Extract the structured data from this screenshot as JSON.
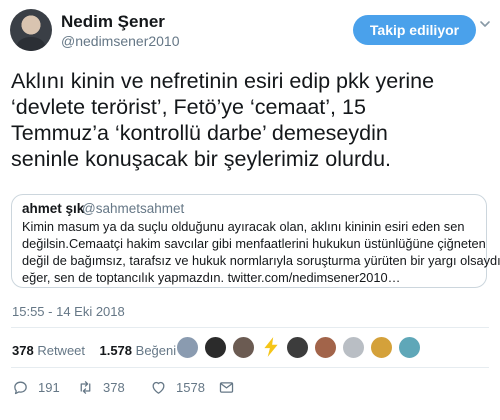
{
  "author": {
    "name": "Nedim Şener",
    "handle": "@nedimsener2010"
  },
  "follow_button": {
    "label": "Takip ediliyor"
  },
  "tweet": {
    "lines": [
      "Aklını kinin ve nefretinin esiri edip pkk yerine",
      "‘devlete terörist’, Fetö’ye ‘cemaat’, 15",
      "Temmuz’a ‘kontrollü darbe’ demeseydin",
      "seninle konuşacak bir şeylerimiz olurdu."
    ]
  },
  "quoted": {
    "name": "ahmet şık",
    "handle": "@sahmetsahmet",
    "lines": [
      "Kimin masum ya da suçlu olduğunu ayıracak olan, aklını kininin esiri eden sen",
      "değilsin.Cemaatçi hakim savcılar gibi menfaatlerini hukukun üstünlüğüne çiğneten",
      "değil de bağımsız, tarafsız ve hukuk normlarıyla soruşturma yürüten bir yargı olsaydı",
      "eğer, sen de toptancılık yapmazdın. twitter.com/nedimsener2010…"
    ]
  },
  "timestamp": "15:55 - 14 Eki 2018",
  "stats": {
    "retweet_count": "378",
    "retweet_label": "Retweet",
    "like_count": "1.578",
    "like_label": "Beğeni"
  },
  "likers": [
    {
      "icon": "user-avatar-icon",
      "color": "#8a9bb0"
    },
    {
      "icon": "user-avatar-icon",
      "color": "#2b2b2b"
    },
    {
      "icon": "user-avatar-icon",
      "color": "#6b5b52"
    },
    {
      "icon": "lightning-avatar-icon",
      "color": "#f5c518"
    },
    {
      "icon": "user-avatar-icon",
      "color": "#3c3c3c"
    },
    {
      "icon": "user-avatar-icon",
      "color": "#a2644a"
    },
    {
      "icon": "user-avatar-icon",
      "color": "#b9bec4"
    },
    {
      "icon": "user-avatar-icon",
      "color": "#d4a13a"
    },
    {
      "icon": "user-avatar-icon",
      "color": "#5fa7b8"
    }
  ],
  "actions": {
    "reply_count": "191",
    "retweet_count": "378",
    "like_count": "1578"
  },
  "colors": {
    "accent": "#4aa1eb",
    "secondary_text": "#657786",
    "border": "#ccd6dd"
  }
}
